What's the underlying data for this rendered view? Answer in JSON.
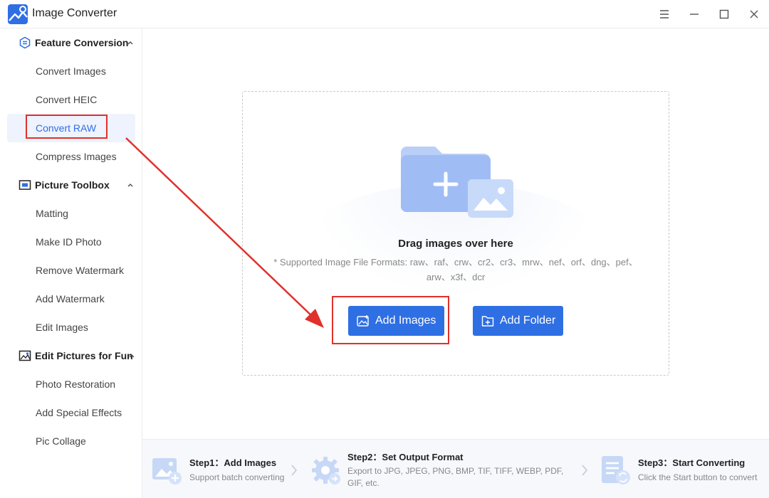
{
  "app": {
    "title": "Image Converter"
  },
  "sidebar": {
    "sections": [
      {
        "label": "Feature Conversion",
        "items": [
          "Convert Images",
          "Convert HEIC",
          "Convert RAW",
          "Compress Images"
        ]
      },
      {
        "label": "Picture Toolbox",
        "items": [
          "Matting",
          "Make ID Photo",
          "Remove Watermark",
          "Add Watermark",
          "Edit Images"
        ]
      },
      {
        "label": "Edit Pictures for Fun",
        "items": [
          "Photo Restoration",
          "Add Special Effects",
          "Pic Collage"
        ]
      }
    ],
    "active_item": "Convert RAW"
  },
  "main": {
    "drag_title": "Drag images over here",
    "formats_line1": "* Supported Image File Formats: raw、raf、crw、cr2、cr3、mrw、nef、orf、dng、pef、",
    "formats_line2": "arw、x3f、dcr",
    "add_images_label": "Add Images",
    "add_folder_label": "Add Folder"
  },
  "steps": [
    {
      "title": "Step1：Add Images",
      "desc": "Support batch converting"
    },
    {
      "title": "Step2：Set Output Format",
      "desc1": "Export to JPG, JPEG, PNG, BMP, TIF, TIFF, WEBP, PDF,",
      "desc2": "GIF, etc."
    },
    {
      "title": "Step3：Start Converting",
      "desc": "Click the Start button to convert"
    }
  ],
  "colors": {
    "accent": "#2f6fe4",
    "highlight": "#e0312b",
    "active_bg": "#eef3fd"
  },
  "icons": {
    "app": "app-logo-icon",
    "window": [
      "menu-icon",
      "minimize-icon",
      "maximize-icon",
      "close-icon"
    ],
    "sections": [
      "feature-conversion-icon",
      "picture-toolbox-icon",
      "edit-pictures-icon"
    ],
    "buttons": [
      "add-image-icon",
      "add-folder-icon"
    ],
    "steps": [
      "add-images-step-icon",
      "settings-gear-icon",
      "convert-document-icon"
    ]
  }
}
